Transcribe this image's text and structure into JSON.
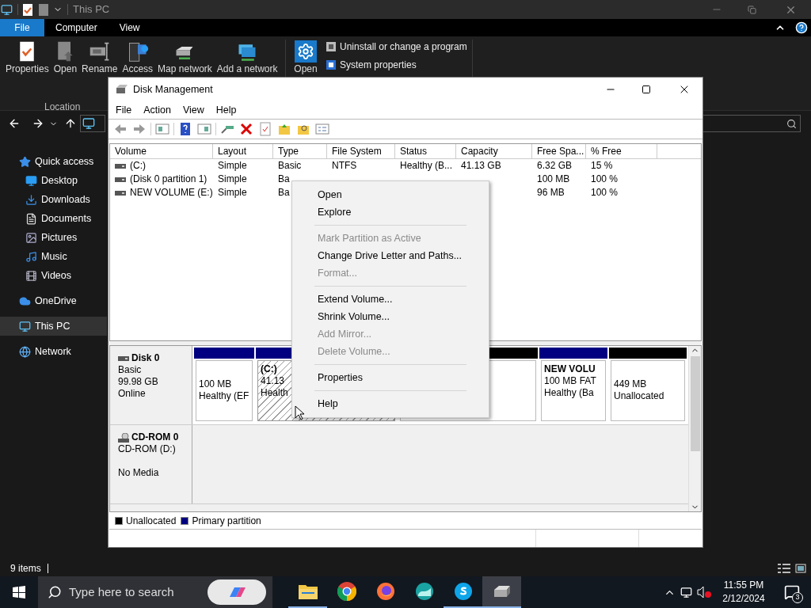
{
  "explorer": {
    "title": "This PC",
    "tabs": [
      {
        "label": "File",
        "selected": true
      },
      {
        "label": "Computer",
        "selected": false
      },
      {
        "label": "View",
        "selected": false
      }
    ],
    "ribbon_buttons": [
      "Properties",
      "Open",
      "Rename",
      "Access",
      "Map network",
      "Add a network"
    ],
    "group_label": "Location",
    "settings_button": "Open",
    "ribbon_links": [
      "Uninstall or change a program",
      "System properties"
    ],
    "nav": [
      {
        "label": "Quick access",
        "selected": false
      },
      {
        "label": "Desktop",
        "selected": false
      },
      {
        "label": "Downloads",
        "selected": false
      },
      {
        "label": "Documents",
        "selected": false
      },
      {
        "label": "Pictures",
        "selected": false
      },
      {
        "label": "Music",
        "selected": false
      },
      {
        "label": "Videos",
        "selected": false
      },
      {
        "label": "OneDrive",
        "selected": false
      },
      {
        "label": "This PC",
        "selected": true
      },
      {
        "label": "Network",
        "selected": false
      }
    ],
    "status": "9 items"
  },
  "taskbar": {
    "search_placeholder": "Type here to search",
    "apps": [
      {
        "kind": "folder",
        "running": true,
        "selected": false
      },
      {
        "kind": "chrome",
        "running": false,
        "selected": false
      },
      {
        "kind": "firefox",
        "running": false,
        "selected": false
      },
      {
        "kind": "wave",
        "running": false,
        "selected": false
      },
      {
        "kind": "skype",
        "running": true,
        "selected": false
      },
      {
        "kind": "disk",
        "running": true,
        "selected": true
      }
    ],
    "time": "11:55 PM",
    "date": "2/12/2024",
    "notifications": "3"
  },
  "disk_management": {
    "title": "Disk Management",
    "menu": [
      "File",
      "Action",
      "View",
      "Help"
    ],
    "columns": [
      "Volume",
      "Layout",
      "Type",
      "File System",
      "Status",
      "Capacity",
      "Free Spa...",
      "% Free"
    ],
    "rows": [
      [
        "(C:)",
        "Simple",
        "Basic",
        "NTFS",
        "Healthy (B...",
        "41.13 GB",
        "6.32 GB",
        "15 %"
      ],
      [
        "(Disk 0 partition 1)",
        "Simple",
        "Ba",
        "",
        "",
        "",
        "100 MB",
        "100 %"
      ],
      [
        "NEW VOLUME (E:)",
        "Simple",
        "Ba",
        "",
        "",
        "",
        "96 MB",
        "100 %"
      ]
    ],
    "disks": [
      {
        "kind": "disk",
        "name": "Disk 0",
        "lines": [
          "Basic",
          "99.98 GB",
          "Online"
        ],
        "partitions": [
          {
            "kind": "primary",
            "selected": false,
            "lines": [
              "100 MB",
              "Healthy (EF"
            ]
          },
          {
            "kind": "primary",
            "selected": true,
            "title": "(C:)",
            "lines": [
              "41.13",
              "Health"
            ]
          },
          {
            "kind": "unallocated",
            "selected": false
          },
          {
            "kind": "primary",
            "selected": false,
            "title": "NEW VOLU",
            "lines": [
              "100 MB FAT",
              "Healthy (Ba"
            ]
          },
          {
            "kind": "unallocated",
            "selected": false,
            "lines": [
              "449 MB",
              "Unallocated"
            ]
          }
        ]
      },
      {
        "kind": "cdrom",
        "name": "CD-ROM 0",
        "lines": [
          "CD-ROM (D:)"
        ],
        "footer": "No Media"
      }
    ],
    "legend": [
      {
        "label": "Unallocated",
        "color": "#000000"
      },
      {
        "label": "Primary partition",
        "color": "#000080"
      }
    ]
  },
  "context_menu": [
    {
      "kind": "item",
      "label": "Open",
      "disabled": false
    },
    {
      "kind": "item",
      "label": "Explore",
      "disabled": false
    },
    {
      "kind": "separator"
    },
    {
      "kind": "item",
      "label": "Mark Partition as Active",
      "disabled": true
    },
    {
      "kind": "item",
      "label": "Change Drive Letter and Paths...",
      "disabled": false
    },
    {
      "kind": "item",
      "label": "Format...",
      "disabled": true
    },
    {
      "kind": "separator"
    },
    {
      "kind": "item",
      "label": "Extend Volume...",
      "disabled": false
    },
    {
      "kind": "item",
      "label": "Shrink Volume...",
      "disabled": false
    },
    {
      "kind": "item",
      "label": "Add Mirror...",
      "disabled": true
    },
    {
      "kind": "item",
      "label": "Delete Volume...",
      "disabled": true
    },
    {
      "kind": "separator"
    },
    {
      "kind": "item",
      "label": "Properties",
      "disabled": false
    },
    {
      "kind": "separator"
    },
    {
      "kind": "item",
      "label": "Help",
      "disabled": false
    }
  ]
}
